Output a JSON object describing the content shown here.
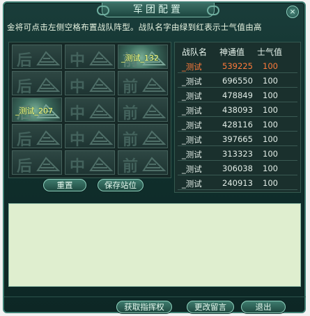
{
  "window": {
    "title": "军团配置",
    "close_glyph": "×"
  },
  "hint": "金将可点击左侧空格布置战队阵型。战队名字由绿到红表示士气值由高",
  "grid": {
    "rows": [
      [
        "后",
        "中",
        "前"
      ],
      [
        "后",
        "中",
        "前"
      ],
      [
        "后",
        "中",
        "前"
      ],
      [
        "后",
        "中",
        "前"
      ],
      [
        "后",
        "中",
        "前"
      ]
    ],
    "occupied": [
      {
        "row": 0,
        "col": 2,
        "label": "_测试_132"
      },
      {
        "row": 2,
        "col": 0,
        "label": "_测试_207"
      }
    ]
  },
  "grid_buttons": {
    "reset": "重置",
    "save": "保存站位"
  },
  "table": {
    "headers": [
      "战队名",
      "神通值",
      "士气值"
    ],
    "rows": [
      {
        "name": "_测试",
        "power": "539225",
        "morale": "100",
        "active": true
      },
      {
        "name": "_测试",
        "power": "696550",
        "morale": "100"
      },
      {
        "name": "_测试",
        "power": "478849",
        "morale": "100"
      },
      {
        "name": "_测试",
        "power": "438093",
        "morale": "100"
      },
      {
        "name": "_测试",
        "power": "428116",
        "morale": "100"
      },
      {
        "name": "_测试",
        "power": "397665",
        "morale": "100"
      },
      {
        "name": "_测试",
        "power": "313323",
        "morale": "100"
      },
      {
        "name": "_测试",
        "power": "306038",
        "morale": "100"
      },
      {
        "name": "_测试",
        "power": "240913",
        "morale": "100"
      }
    ]
  },
  "message": "",
  "footer": {
    "command": "获取指挥权",
    "edit_msg": "更改留言",
    "exit": "退出"
  },
  "colors": {
    "active_row": "#ff7a3a",
    "occupied_label": "#fff87c"
  }
}
